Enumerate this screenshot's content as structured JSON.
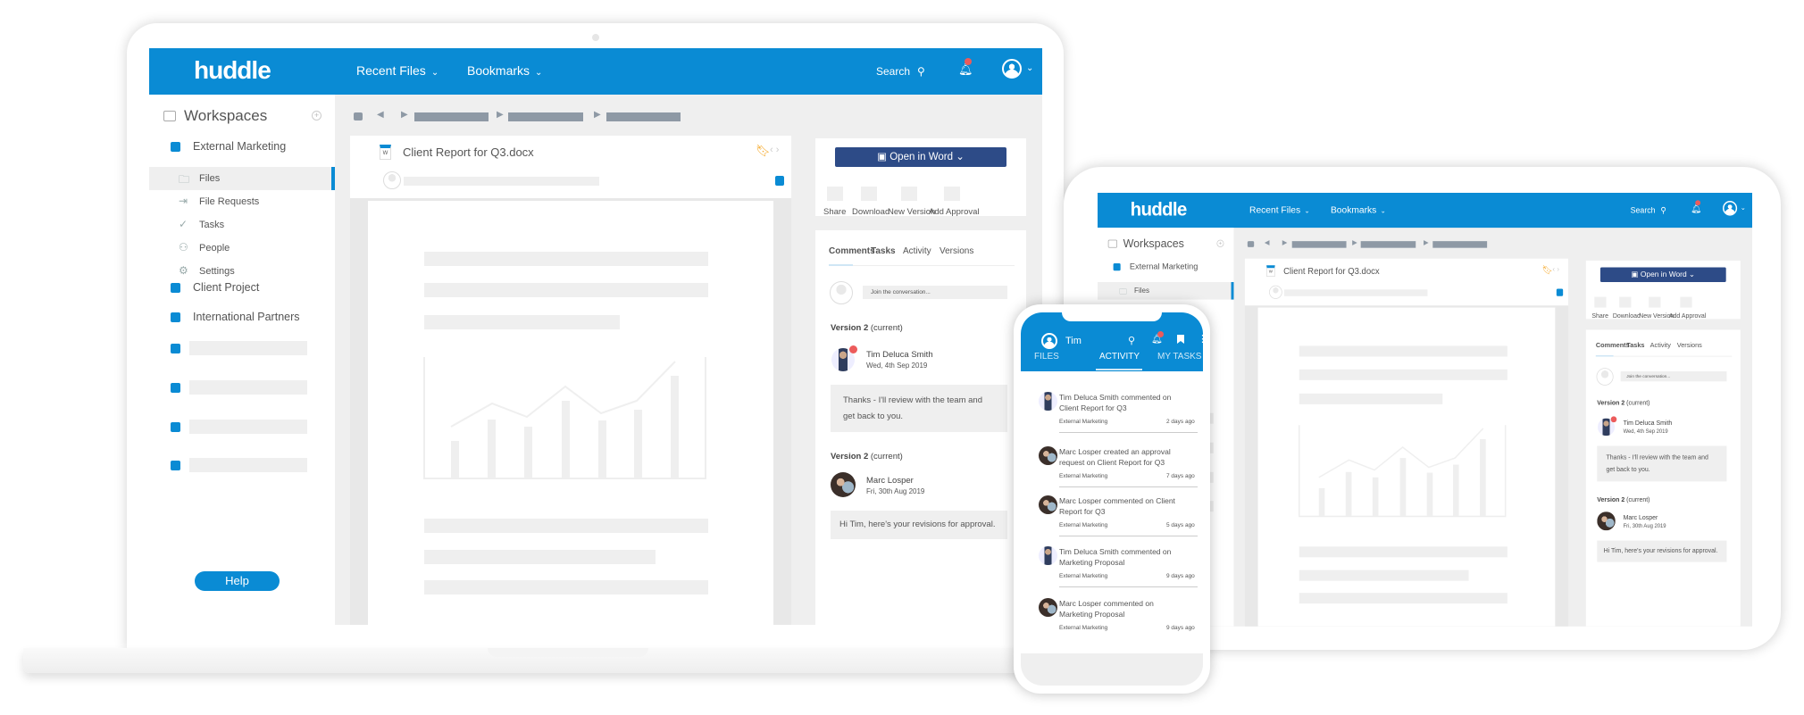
{
  "app": {
    "logo": "huddle",
    "brand_color": "#0a8bd4",
    "button_color": "#2d4b87"
  },
  "header": {
    "recent_files": "Recent Files",
    "bookmarks": "Bookmarks",
    "search": "Search",
    "icons": [
      "search-icon",
      "bell-icon",
      "user-avatar-icon"
    ]
  },
  "sidebar": {
    "title": "Workspaces",
    "workspaces": [
      {
        "label": "External Marketing"
      },
      {
        "label": "Client Project"
      },
      {
        "label": "International Partners"
      }
    ],
    "sub_items": [
      {
        "label": "Files",
        "icon": "folder-icon"
      },
      {
        "label": "File Requests",
        "icon": "file-request-icon"
      },
      {
        "label": "Tasks",
        "icon": "check-circle-icon"
      },
      {
        "label": "People",
        "icon": "people-icon"
      },
      {
        "label": "Settings",
        "icon": "gear-icon"
      }
    ],
    "help": "Help"
  },
  "document": {
    "title": "Client Report for Q3.docx",
    "file_type": "W"
  },
  "actions": {
    "open_in_word": "Open in Word",
    "share": "Share",
    "download": "Download",
    "new_version": "New Version",
    "add_approval": "Add Approval"
  },
  "tabs": [
    "Comments",
    "Tasks",
    "Activity",
    "Versions"
  ],
  "comments": {
    "placeholder": "Join the conversation...",
    "entries": [
      {
        "version": "Version 2",
        "status": "(current)",
        "author": "Tim Deluca Smith",
        "date": "Wed, 4th Sep 2019",
        "text": "Thanks - I'll review with the team and get back to you."
      },
      {
        "version": "Version 2",
        "status": "(current)",
        "author": "Marc Losper",
        "date": "Fri, 30th Aug 2019",
        "text": "Hi Tim, here's your revisions for approval."
      }
    ]
  },
  "mobile": {
    "user": "Tim",
    "tabs": [
      "FILES",
      "ACTIVITY",
      "MY TASKS"
    ],
    "active_tab": "ACTIVITY",
    "activity": [
      {
        "text": "Tim Deluca Smith commented on Client Report for Q3",
        "workspace": "External Marketing",
        "time": "2 days ago",
        "avatar": "tim"
      },
      {
        "text": "Marc Losper created an approval request on Client Report for Q3",
        "workspace": "External Marketing",
        "time": "7 days ago",
        "avatar": "marc"
      },
      {
        "text": "Marc Losper commented on Client Report for Q3",
        "workspace": "External Marketing",
        "time": "5 days ago",
        "avatar": "marc"
      },
      {
        "text": "Tim Deluca Smith commented on Marketing Proposal",
        "workspace": "External Marketing",
        "time": "9 days ago",
        "avatar": "tim"
      },
      {
        "text": "Marc Losper commented on Marketing Proposal",
        "workspace": "External Marketing",
        "time": "9 days ago",
        "avatar": "marc"
      }
    ]
  }
}
